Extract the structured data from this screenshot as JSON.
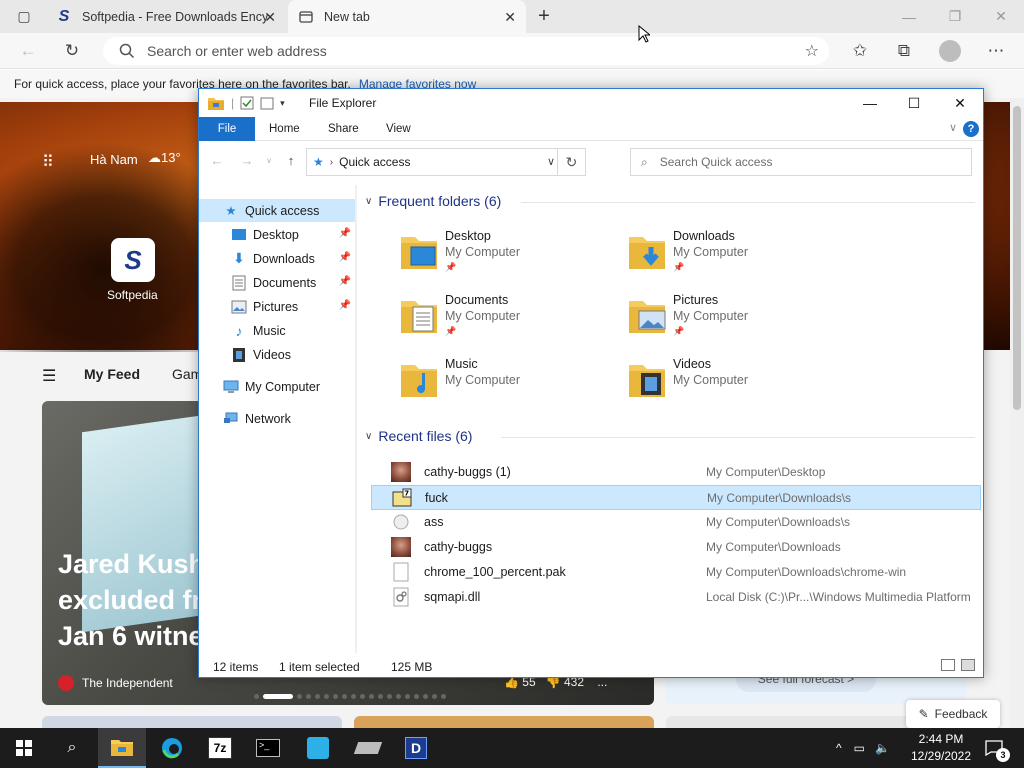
{
  "browser": {
    "tabs": [
      {
        "title": "Softpedia - Free Downloads Ency",
        "close": "✕"
      },
      {
        "title": "New tab",
        "close": "✕"
      }
    ],
    "new_tab": "+",
    "address_placeholder": "Search or enter web address",
    "favbar_text": "For quick access, place your favorites here on the favorites bar.",
    "favbar_link": "Manage favorites now"
  },
  "newtab": {
    "location": "Hà Nam",
    "temperature": "13°",
    "shortcut": "Softpedia",
    "shortcut_letter": "S",
    "feed_tabs": [
      "My Feed",
      "Gam"
    ],
    "headline_lines": [
      "Jared Kushr",
      "excluded fr",
      "Jan 6 witne"
    ],
    "source": "The Independent",
    "likes": "55",
    "dislikes": "432",
    "more": "...",
    "forecast_button": "See full forecast >",
    "feedback": "Feedback"
  },
  "explorer": {
    "title": "File Explorer",
    "ribbon_tabs": [
      "File",
      "Home",
      "Share",
      "View"
    ],
    "help": "?",
    "address_crumb": "Quick access",
    "search_placeholder": "Search Quick access",
    "nav": [
      {
        "label": "Quick access",
        "icon": "star-icon",
        "pinned": false
      },
      {
        "label": "Desktop",
        "icon": "desktop-folder-icon",
        "pinned": true
      },
      {
        "label": "Downloads",
        "icon": "downloads-arrow-icon",
        "pinned": true
      },
      {
        "label": "Documents",
        "icon": "documents-icon",
        "pinned": true
      },
      {
        "label": "Pictures",
        "icon": "pictures-icon",
        "pinned": true
      },
      {
        "label": "Music",
        "icon": "music-note-icon",
        "pinned": false
      },
      {
        "label": "Videos",
        "icon": "video-film-icon",
        "pinned": false
      },
      {
        "label": "My Computer",
        "icon": "computer-icon",
        "pinned": false
      },
      {
        "label": "Network",
        "icon": "network-icon",
        "pinned": false
      }
    ],
    "frequent_header": "Frequent folders (6)",
    "frequent": [
      {
        "name": "Desktop",
        "location": "My Computer",
        "pinned": true
      },
      {
        "name": "Downloads",
        "location": "My Computer",
        "pinned": true
      },
      {
        "name": "Documents",
        "location": "My Computer",
        "pinned": true
      },
      {
        "name": "Pictures",
        "location": "My Computer",
        "pinned": true
      },
      {
        "name": "Music",
        "location": "My Computer",
        "pinned": false
      },
      {
        "name": "Videos",
        "location": "My Computer",
        "pinned": false
      }
    ],
    "recent_header": "Recent files (6)",
    "recent": [
      {
        "name": "cathy-buggs (1)",
        "path": "My Computer\\Desktop",
        "icon": "photo-thumbnail-icon"
      },
      {
        "name": "fuck",
        "path": "My Computer\\Downloads\\s",
        "icon": "7z-archive-icon"
      },
      {
        "name": "ass",
        "path": "My Computer\\Downloads\\s",
        "icon": "generic-file-icon"
      },
      {
        "name": "cathy-buggs",
        "path": "My Computer\\Downloads",
        "icon": "photo-thumbnail-icon"
      },
      {
        "name": "chrome_100_percent.pak",
        "path": "My Computer\\Downloads\\chrome-win",
        "icon": "blank-file-icon"
      },
      {
        "name": "sqmapi.dll",
        "path": "Local Disk (C:)\\Pr...\\Windows Multimedia Platform",
        "icon": "dll-file-icon"
      }
    ],
    "status_items": "12 items",
    "status_selected": "1 item selected",
    "status_size": "125 MB"
  },
  "taskbar": {
    "time": "2:44 PM",
    "date": "12/29/2022",
    "notifications": "3",
    "seven_zip_label": "7z",
    "d_label": "D"
  },
  "colors": {
    "accent": "#1a6fc9",
    "selection": "#cce8ff",
    "group_header": "#1e3287"
  }
}
